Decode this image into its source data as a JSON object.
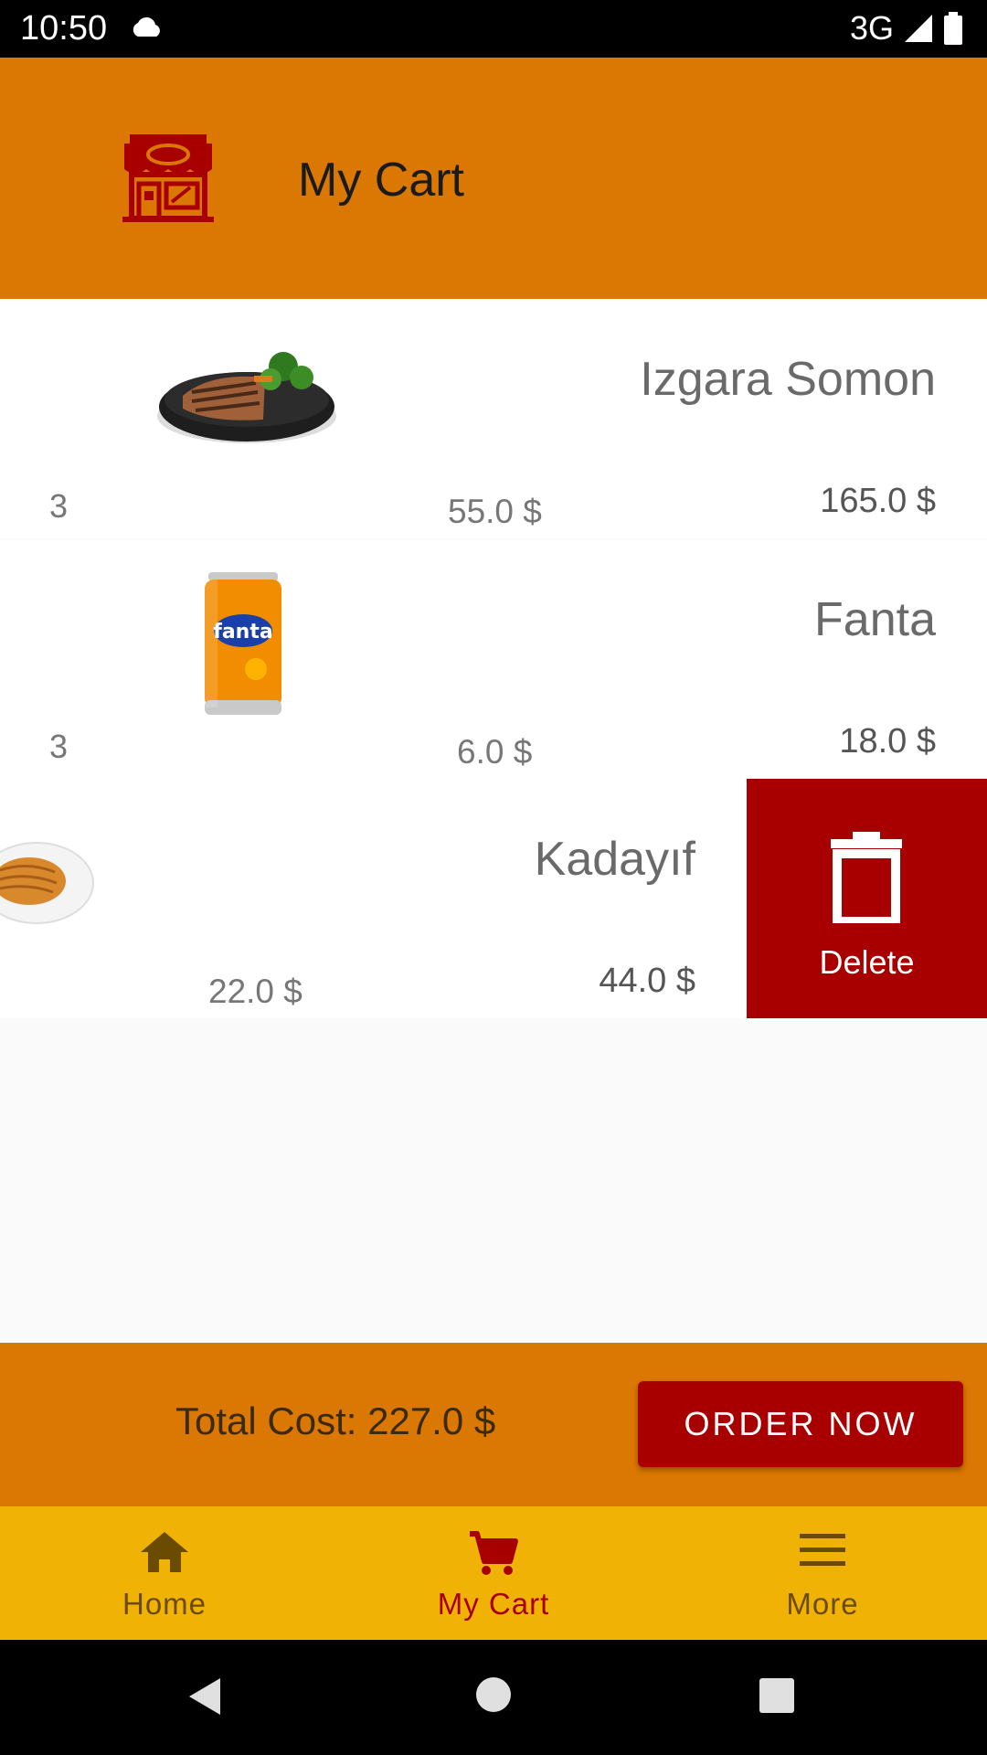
{
  "status_bar": {
    "time": "10:50",
    "network": "3G"
  },
  "app_bar": {
    "title": "My Cart",
    "icon": "store-icon"
  },
  "cart": {
    "items": [
      {
        "name": "Izgara Somon",
        "quantity": "3",
        "unit_price": "55.0 $",
        "total": "165.0 $",
        "image": "grilled-salmon"
      },
      {
        "name": "Fanta",
        "quantity": "3",
        "unit_price": "6.0 $",
        "total": "18.0 $",
        "image": "fanta-can"
      },
      {
        "name": "Kadayıf",
        "unit_price": "22.0 $",
        "total": "44.0 $",
        "image": "kadayif-plate",
        "swiped_for_delete": true
      }
    ],
    "delete_label": "Delete"
  },
  "footer": {
    "total_cost": "Total Cost: 227.0 $",
    "order_button": "ORDER NOW"
  },
  "bottom_nav": {
    "items": [
      {
        "label": "Home",
        "icon": "home-icon"
      },
      {
        "label": "My Cart",
        "icon": "cart-icon",
        "active": true
      },
      {
        "label": "More",
        "icon": "menu-icon"
      }
    ]
  },
  "colors": {
    "primary": "#db7703",
    "accent": "#a80001",
    "nav_bar": "#f0b305"
  }
}
